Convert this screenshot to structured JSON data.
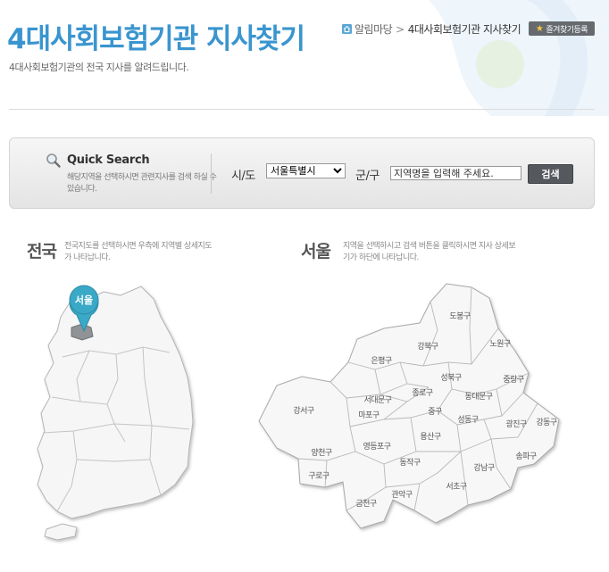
{
  "header": {
    "title": "4대사회보험기관 지사찾기",
    "subtitle": "4대사회보험기관의 전국 지사를 알려드립니다."
  },
  "breadcrumb": {
    "items": [
      "알림마당",
      "4대사회보험기관 지사찾기"
    ],
    "separator": ">"
  },
  "favorite_button": {
    "label": "즐겨찾기등록"
  },
  "quick_search": {
    "title": "Quick Search",
    "description": "해당지역을 선택하시면 관련지사를 검색 하실 수 있습니다.",
    "sido_label": "시/도",
    "sido_selected": "서울특별시",
    "gungu_label": "군/구",
    "region_input_value": "지역명을 입력해 주세요.",
    "search_button": "검색"
  },
  "national_map": {
    "heading": "전국",
    "description": "전국지도를 선택하시면 우측에 지역별 상세지도가 나타납니다.",
    "selected_pin": "서울"
  },
  "seoul_map": {
    "heading": "서울",
    "description": "지역을 선택하시고 검색 버튼을 클릭하시면 지사 상세보기가 하단에 나타납니다.",
    "districts": [
      "도봉구",
      "강북구",
      "노원구",
      "은평구",
      "성북구",
      "중랑구",
      "종로구",
      "동대문구",
      "서대문구",
      "강서구",
      "마포구",
      "중구",
      "성동구",
      "광진구",
      "강동구",
      "용산구",
      "양천구",
      "영등포구",
      "동작구",
      "송파구",
      "구로구",
      "강남구",
      "관악구",
      "서초구",
      "금천구"
    ]
  },
  "colors": {
    "title_blue": "#3a95cf",
    "pin_teal": "#3aa9c7",
    "button_dark": "#55585c"
  }
}
